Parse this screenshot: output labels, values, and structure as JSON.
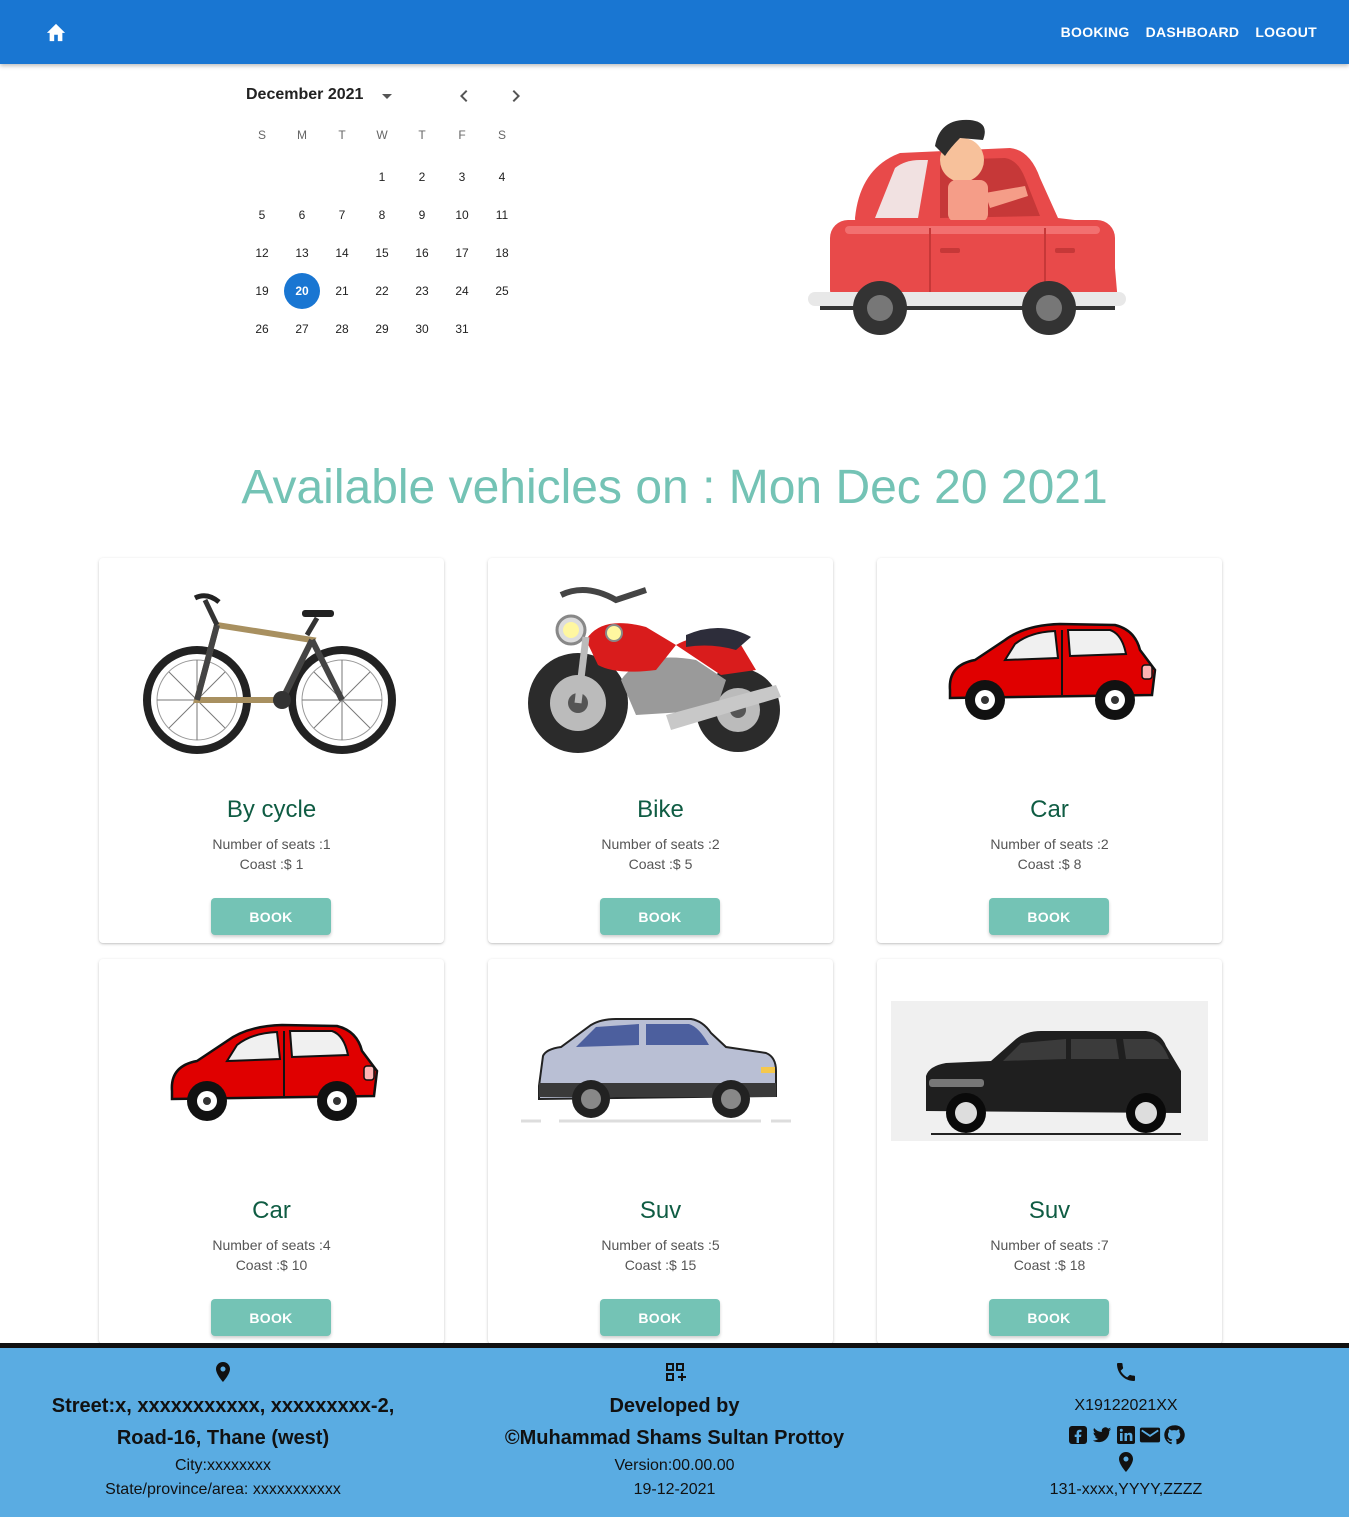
{
  "nav": {
    "booking": "BOOKING",
    "dashboard": "DASHBOARD",
    "logout": "LOGOUT",
    "home_icon": "home-icon"
  },
  "calendar": {
    "month_label": "December 2021",
    "weekdays": [
      "S",
      "M",
      "T",
      "W",
      "T",
      "F",
      "S"
    ],
    "weeks": [
      [
        "",
        "",
        "",
        "1",
        "2",
        "3",
        "4"
      ],
      [
        "5",
        "6",
        "7",
        "8",
        "9",
        "10",
        "11"
      ],
      [
        "12",
        "13",
        "14",
        "15",
        "16",
        "17",
        "18"
      ],
      [
        "19",
        "20",
        "21",
        "22",
        "23",
        "24",
        "25"
      ],
      [
        "26",
        "27",
        "28",
        "29",
        "30",
        "31",
        ""
      ]
    ],
    "selected_day": "20"
  },
  "heading": "Available vehicles on : Mon Dec 20 2021",
  "vehicles": [
    {
      "name": "By cycle",
      "seats": "Number of seats :1",
      "cost": "Coast :$ 1",
      "button": "BOOK",
      "image": "bicycle"
    },
    {
      "name": "Bike",
      "seats": "Number of seats :2",
      "cost": "Coast :$ 5",
      "button": "BOOK",
      "image": "motorbike"
    },
    {
      "name": "Car",
      "seats": "Number of seats :2",
      "cost": "Coast :$ 8",
      "button": "BOOK",
      "image": "red-car"
    },
    {
      "name": "Car",
      "seats": "Number of seats :4",
      "cost": "Coast :$ 10",
      "button": "BOOK",
      "image": "red-car"
    },
    {
      "name": "Suv",
      "seats": "Number of seats :5",
      "cost": "Coast :$ 15",
      "button": "BOOK",
      "image": "silver-suv"
    },
    {
      "name": "Suv",
      "seats": "Number of seats :7",
      "cost": "Coast :$ 18",
      "button": "BOOK",
      "image": "black-suv"
    }
  ],
  "footer": {
    "address_line1": "Street:x, xxxxxxxxxxx, xxxxxxxxx-2,",
    "address_line2": "Road-16, Thane (west)",
    "city": "City:xxxxxxxx",
    "state": "State/province/area: xxxxxxxxxxx",
    "dev_line1": "Developed by",
    "dev_line2": "©Muhammad Shams Sultan Prottoy",
    "version": "Version:00.00.00",
    "date": "19-12-2021",
    "phone": "X19122021XX",
    "location_code": "131-xxxx,YYYY,ZZZZ"
  },
  "colors": {
    "appbar": "#1976d2",
    "accent": "#74c3b5",
    "title": "#0f5c43",
    "footer": "#5aace2"
  }
}
